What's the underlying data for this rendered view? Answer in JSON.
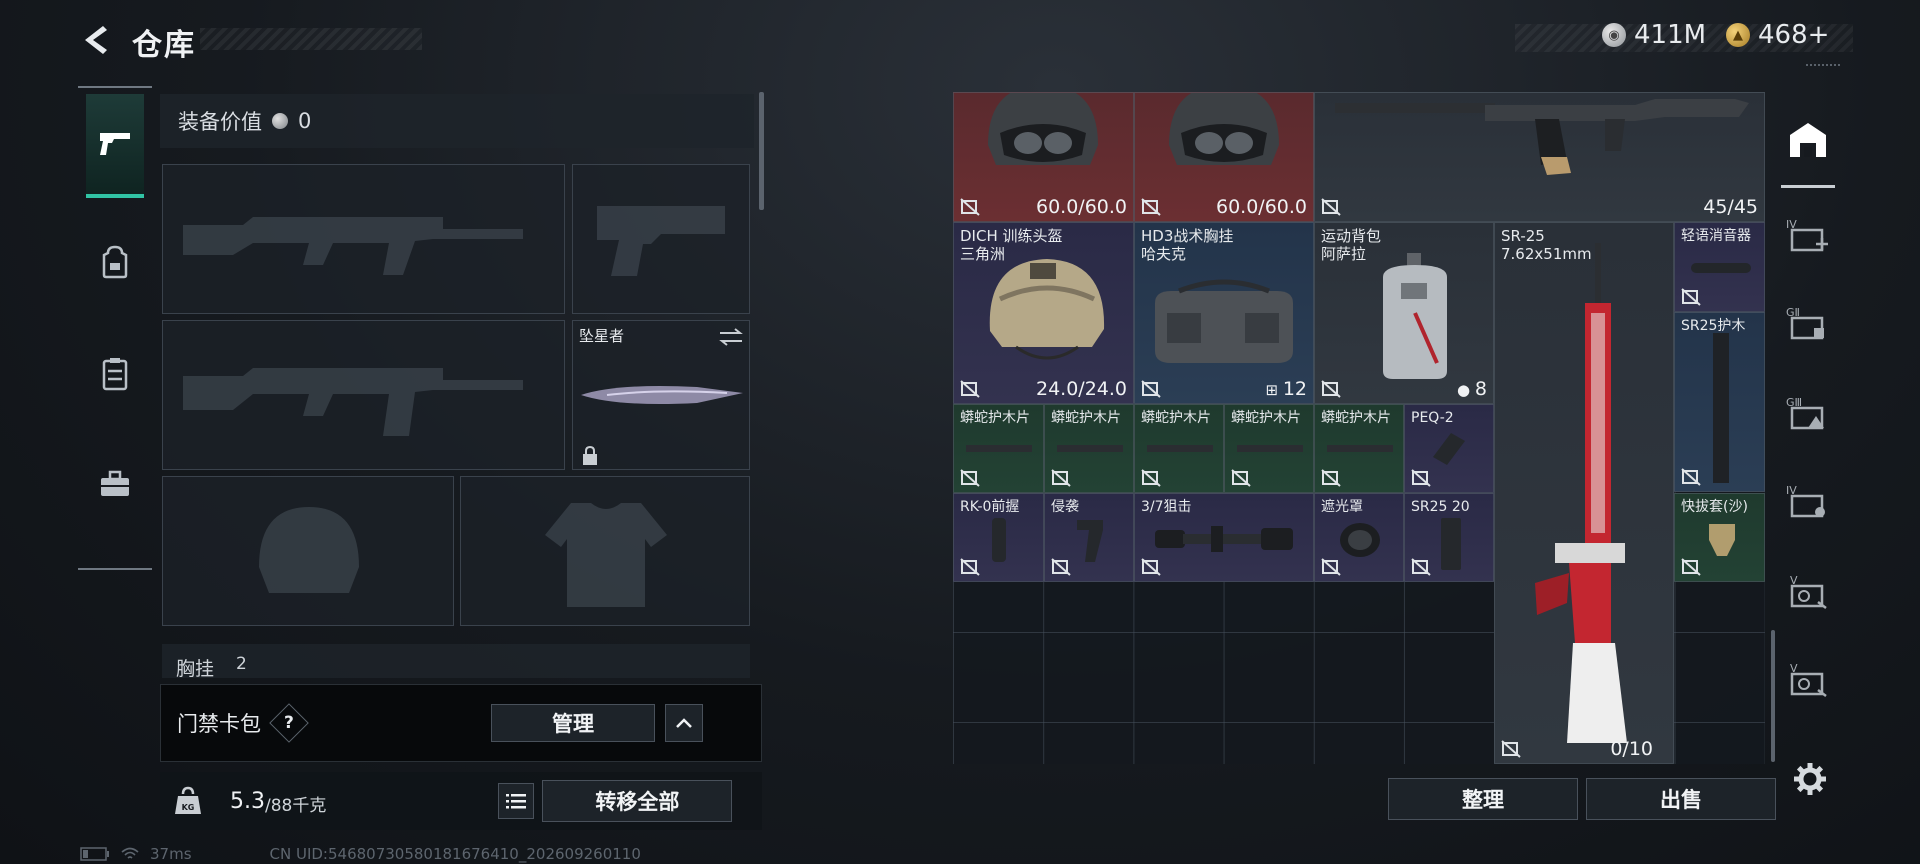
{
  "header": {
    "title": "仓库",
    "currencies": [
      {
        "icon": "silver-coin-icon",
        "value": "411M"
      },
      {
        "icon": "gold-coin-icon",
        "value": "468+"
      }
    ]
  },
  "left_nav": {
    "items": [
      {
        "icon": "pistol-icon",
        "active": true
      },
      {
        "icon": "backpack-icon",
        "active": false
      },
      {
        "icon": "vest-icon",
        "active": false
      },
      {
        "icon": "toolbox-icon",
        "active": false
      }
    ]
  },
  "equipment": {
    "value_label": "装备价值",
    "value": "0",
    "melee": {
      "name": "坠星者"
    },
    "chest_rig_label": "胸挂",
    "chest_rig_count": "2"
  },
  "keycard_bar": {
    "label": "门禁卡包",
    "help": "?",
    "manage_label": "管理"
  },
  "weight_bar": {
    "icon_text": "KG",
    "current": "5.3",
    "capacity": "/88千克",
    "transfer_label": "转移全部"
  },
  "status_bar": {
    "ping": "37ms",
    "uid": "CN UID:54680730580181676410_202609260110"
  },
  "grid_items": [
    {
      "id": "helmet1",
      "name": "",
      "value": "60.0/60.0",
      "color": "red"
    },
    {
      "id": "helmet2",
      "name": "",
      "value": "60.0/60.0",
      "color": "red"
    },
    {
      "id": "rifle",
      "name": "",
      "value": "45/45",
      "color": "grey"
    },
    {
      "id": "dich",
      "name": "DICH 训练头盔\n三角洲",
      "value": "24.0/24.0",
      "color": "purple"
    },
    {
      "id": "hd3",
      "name": "HD3战术胸挂\n哈夫克",
      "value": "12",
      "color": "blue"
    },
    {
      "id": "backpack",
      "name": "运动背包\n阿萨拉",
      "value": "8",
      "color": "grey"
    },
    {
      "id": "sr25",
      "name": "SR-25\n7.62x51mm",
      "value": "0/10",
      "color": "grey"
    },
    {
      "id": "silencer",
      "name": "轻语消音器",
      "value": "",
      "color": "purple"
    },
    {
      "id": "sr25-guard",
      "name": "SR25护木",
      "value": "",
      "color": "blue"
    },
    {
      "id": "handguard1",
      "name": "蟒蛇护木片",
      "value": "",
      "color": "green"
    },
    {
      "id": "handguard2",
      "name": "蟒蛇护木片",
      "value": "",
      "color": "green"
    },
    {
      "id": "handguard3",
      "name": "蟒蛇护木片",
      "value": "",
      "color": "green"
    },
    {
      "id": "handguard4",
      "name": "蟒蛇护木片",
      "value": "",
      "color": "green"
    },
    {
      "id": "handguard5",
      "name": "蟒蛇护木片",
      "value": "",
      "color": "green"
    },
    {
      "id": "peq2",
      "name": "PEQ-2",
      "value": "",
      "color": "purple"
    },
    {
      "id": "rk0",
      "name": "RK-0前握",
      "value": "",
      "color": "purple"
    },
    {
      "id": "raid",
      "name": "侵袭",
      "value": "",
      "color": "purple"
    },
    {
      "id": "scope",
      "name": "3/7狙击",
      "value": "",
      "color": "purple"
    },
    {
      "id": "shade",
      "name": "遮光罩",
      "value": "",
      "color": "purple"
    },
    {
      "id": "mag",
      "name": "SR25 20",
      "value": "",
      "color": "purple"
    },
    {
      "id": "holster",
      "name": "快拔套(沙)",
      "value": "",
      "color": "green"
    }
  ],
  "right_nav": {
    "items": [
      {
        "icon": "storage-icon",
        "label": ""
      },
      {
        "icon": "expand-case-icon",
        "label": "IV"
      },
      {
        "icon": "case-g1-icon",
        "label": "GⅡ"
      },
      {
        "icon": "case-g3-icon",
        "label": "GⅢ"
      },
      {
        "icon": "case-iv-icon",
        "label": "IV"
      },
      {
        "icon": "case-v-icon",
        "label": "V"
      },
      {
        "icon": "case-v2-icon",
        "label": "V"
      }
    ]
  },
  "bottom_buttons": {
    "sort_label": "整理",
    "sell_label": "出售"
  }
}
